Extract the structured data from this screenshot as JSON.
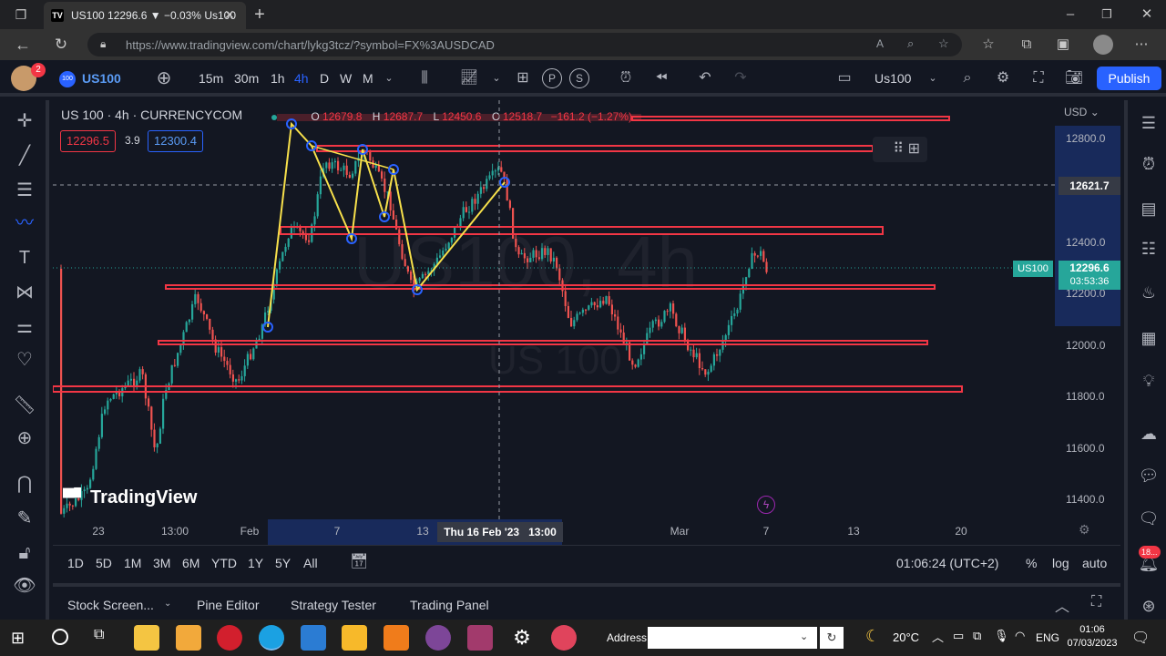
{
  "browser": {
    "tab_title": "US100 12296.6 ▼ −0.03% Us100",
    "url": "https://www.tradingview.com/chart/lykg3tcz/?symbol=FX%3AUSDCAD"
  },
  "toolbar": {
    "avatar_badge": "2",
    "symbol": "US100",
    "symbol_badge": "100",
    "intervals": [
      "15m",
      "30m",
      "1h",
      "4h",
      "D",
      "W",
      "M"
    ],
    "active_interval": "4h",
    "layout_name": "Us100",
    "publish_label": "Publish"
  },
  "chart": {
    "title": "US 100 · 4h · CURRENCYCOM",
    "ohlc_o_label": "O",
    "ohlc_o": "12679.8",
    "ohlc_h_label": "H",
    "ohlc_h": "12687.7",
    "ohlc_l_label": "L",
    "ohlc_l": "12450.6",
    "ohlc_c_label": "C",
    "ohlc_c": "12518.7",
    "ohlc_change": "−161.2 (−1.27%)",
    "bid": "12296.5",
    "spread": "3.9",
    "ask": "12300.4",
    "currency": "USD",
    "watermark_big": "US100, 4h",
    "watermark_small": "US 100",
    "logo_text": "TradingView",
    "crosshair_price": "12621.7",
    "last_symbol": "US100",
    "last_price": "12296.6",
    "countdown": "03:53:36",
    "crosshair_time": "Thu 16 Feb '23   13:00"
  },
  "chart_data": {
    "type": "candlestick",
    "price_ticks": [
      "12800.0",
      "12400.0",
      "12200.0",
      "12000.0",
      "11800.0",
      "11600.0",
      "11400.0"
    ],
    "time_ticks": [
      "23",
      "13:00",
      "Feb",
      "7",
      "13",
      "Mar",
      "7",
      "13",
      "20"
    ],
    "colors": {
      "up": "#26a69a",
      "down": "#ef5350",
      "zones": "#f23645",
      "pattern": "#f7e04b",
      "nodes": "#2962ff"
    }
  },
  "range_bar": {
    "ranges": [
      "1D",
      "5D",
      "1M",
      "3M",
      "6M",
      "YTD",
      "1Y",
      "5Y",
      "All"
    ],
    "clock": "01:06:24 (UTC+2)",
    "percent": "%",
    "log": "log",
    "auto": "auto"
  },
  "panels": {
    "stock_screener": "Stock Screen...",
    "pine_editor": "Pine Editor",
    "strategy_tester": "Strategy Tester",
    "trading_panel": "Trading Panel"
  },
  "right_toolbar": {
    "notifications_badge": "18..."
  },
  "taskbar": {
    "address_label": "Address",
    "weather": "20°C",
    "lang": "ENG",
    "time": "01:06",
    "date": "07/03/2023"
  }
}
